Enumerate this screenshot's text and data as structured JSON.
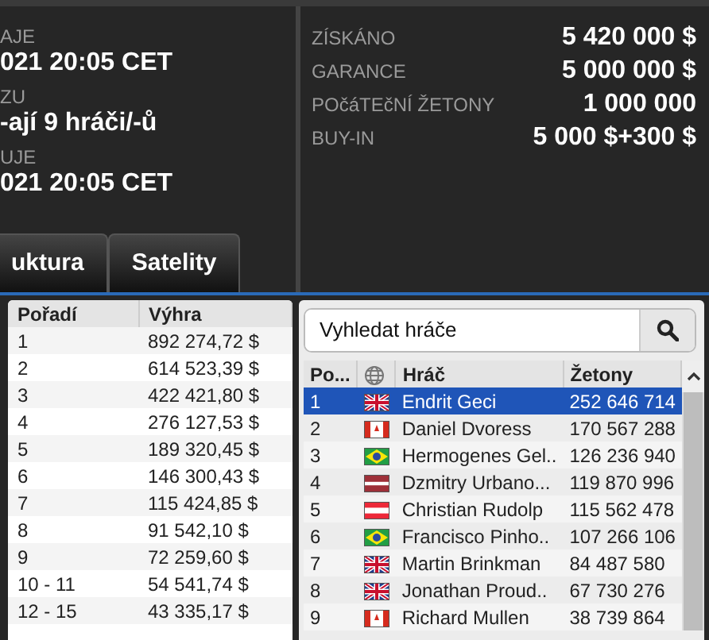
{
  "schedule": [
    {
      "label": "AJE",
      "value": "021  20:05 CET"
    },
    {
      "label": "ZU",
      "value": "-ají 9 hráči/-ů"
    },
    {
      "label": "UJE",
      "value": "021  20:05 CET"
    }
  ],
  "tabs": [
    {
      "label": "uktura",
      "selected": false
    },
    {
      "label": "Satelity",
      "selected": false
    }
  ],
  "stats": [
    {
      "label": "ZÍSKÁNO",
      "value": "5 420 000 $"
    },
    {
      "label": "GARANCE",
      "value": "5 000 000 $"
    },
    {
      "label": "POčáTEčNÍ ŽETONY",
      "value": "1 000 000"
    },
    {
      "label": "BUY-IN",
      "value": "5 000 $+300 $"
    }
  ],
  "payouts": {
    "columns": [
      "Pořadí",
      "Výhra"
    ],
    "rows": [
      [
        "1",
        "892 274,72 $"
      ],
      [
        "2",
        "614 523,39 $"
      ],
      [
        "3",
        "422 421,80 $"
      ],
      [
        "4",
        "276 127,53 $"
      ],
      [
        "5",
        "189 320,45 $"
      ],
      [
        "6",
        "146 300,43 $"
      ],
      [
        "7",
        "115 424,85 $"
      ],
      [
        "8",
        "91 542,10 $"
      ],
      [
        "9",
        "72 259,60 $"
      ],
      [
        "10 - 11",
        "54 541,74 $"
      ],
      [
        "12 - 15",
        "43 335,17 $"
      ]
    ]
  },
  "players": {
    "search": {
      "placeholder": "Vyhledat hráče"
    },
    "columns": [
      "Po...",
      "Hráč",
      "Žetony"
    ],
    "rows": [
      {
        "rank": "1",
        "kind": "gb",
        "name": "Endrit Geci",
        "chips": "252 646 714",
        "selected": true
      },
      {
        "rank": "2",
        "kind": "ca",
        "name": "Daniel Dvoress",
        "chips": "170 567 288",
        "selected": false
      },
      {
        "rank": "3",
        "kind": "br",
        "name": "Hermogenes Gel..",
        "chips": "126 236 940",
        "selected": false
      },
      {
        "rank": "4",
        "kind": "lv",
        "name": "Dzmitry Urbano...",
        "chips": "119 870 996",
        "selected": false
      },
      {
        "rank": "5",
        "kind": "at",
        "name": "Christian Rudolp",
        "chips": "115 562 478",
        "selected": false
      },
      {
        "rank": "6",
        "kind": "br",
        "name": "Francisco Pinho..",
        "chips": "107 266 106",
        "selected": false
      },
      {
        "rank": "7",
        "kind": "gb",
        "name": "Martin Brinkman",
        "chips": "84 487 580",
        "selected": false
      },
      {
        "rank": "8",
        "kind": "gb",
        "name": "Jonathan Proud..",
        "chips": "67 730 276",
        "selected": false
      },
      {
        "rank": "9",
        "kind": "ca",
        "name": "Richard Mullen",
        "chips": "38 739 864",
        "selected": false
      }
    ]
  }
}
